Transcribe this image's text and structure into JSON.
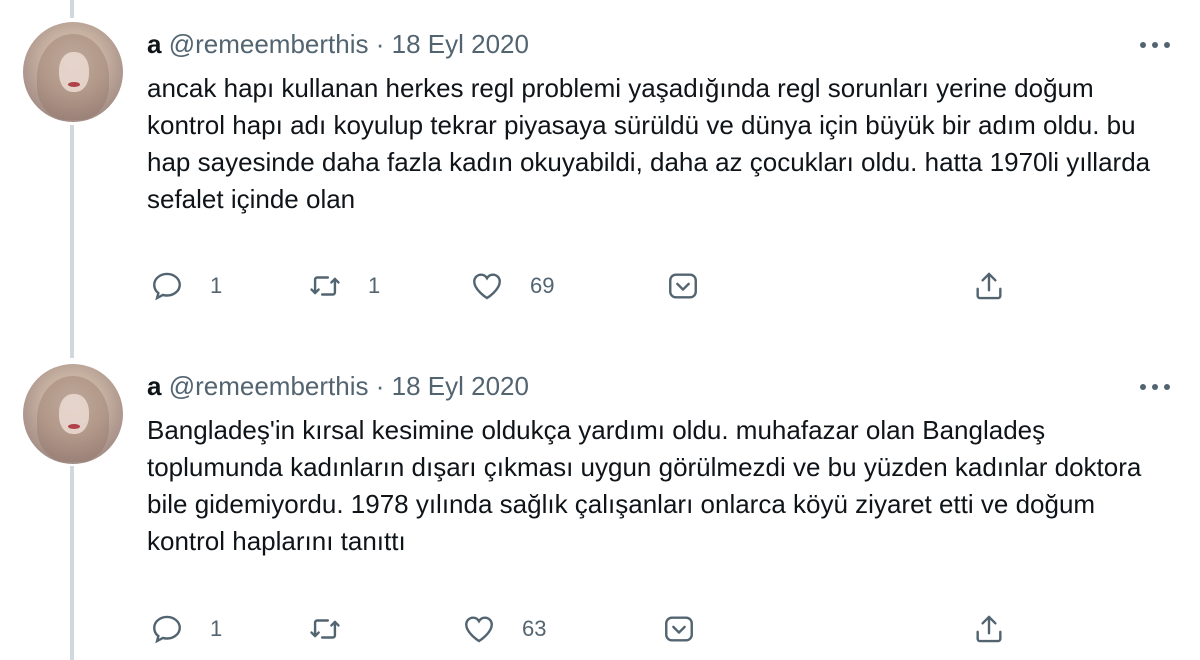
{
  "tweets": [
    {
      "author_name": "a",
      "handle": "@remeemberthis",
      "separator": "·",
      "date": "18 Eyl 2020",
      "text": "ancak hapı kullanan herkes regl problemi yaşadığında regl sorunları yerine doğum kontrol hapı adı koyulup tekrar piyasaya sürüldü ve dünya için büyük bir adım oldu. bu hap sayesinde daha fazla kadın okuyabildi, daha az çocukları oldu. hatta 1970li yıllarda sefalet içinde olan",
      "reply_count": "1",
      "retweet_count": "1",
      "like_count": "69"
    },
    {
      "author_name": "a",
      "handle": "@remeemberthis",
      "separator": "·",
      "date": "18 Eyl 2020",
      "text": "Bangladeş'in kırsal kesimine oldukça yardımı oldu. muhafazar olan Bangladeş toplumunda kadınların dışarı çıkması uygun görülmezdi ve bu yüzden kadınlar doktora bile gidemiyordu. 1978 yılında sağlık çalışanları onlarca köyü ziyaret etti ve doğum kontrol haplarını tanıttı",
      "reply_count": "1",
      "retweet_count": "",
      "like_count": "63"
    }
  ],
  "icons": {
    "reply": "speech-bubble-icon",
    "retweet": "retweet-arrows-icon",
    "like": "heart-icon",
    "downvote": "chevron-box-icon",
    "share": "share-upload-icon",
    "more": "ellipsis-icon"
  },
  "colors": {
    "text_primary": "#0f1419",
    "text_secondary": "#536471",
    "thread_line": "#cfd9de",
    "background": "#ffffff"
  }
}
